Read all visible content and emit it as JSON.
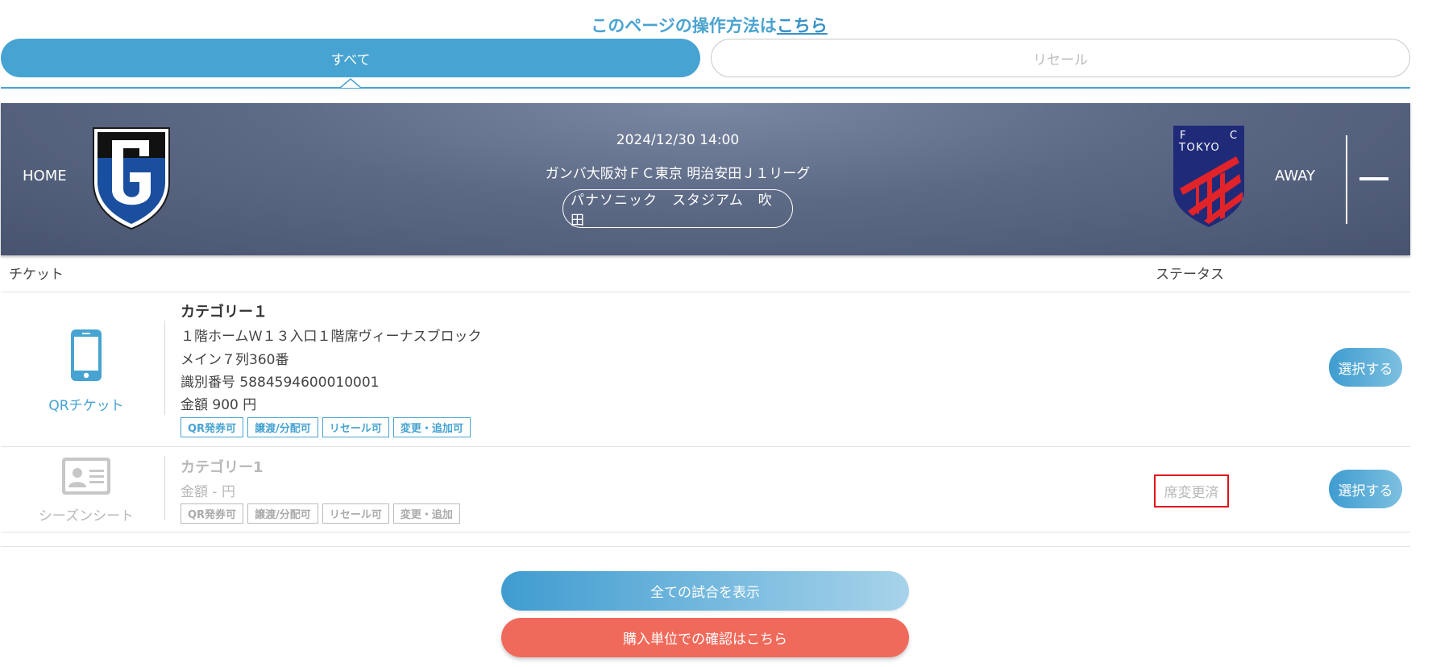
{
  "howto": {
    "prefix": "このページの操作方法は",
    "link": "こちら"
  },
  "tabs": [
    {
      "label": "すべて",
      "active": true
    },
    {
      "label": "リセール",
      "active": false
    }
  ],
  "match": {
    "home_label": "HOME",
    "away_label": "AWAY",
    "date": "2024/12/30 14:00",
    "name": "ガンバ大阪対ＦＣ東京 明治安田Ｊ１リーグ",
    "venue": "パナソニック　スタジアム　吹田",
    "home_logo_icon": "gamba-osaka-emblem-icon",
    "away_logo_icon": "fc-tokyo-emblem-icon",
    "away_logo_text": {
      "f": "F",
      "c": "C",
      "tokyo": "TOKYO"
    }
  },
  "columns": {
    "ticket": "チケット",
    "status": "ステータス"
  },
  "tickets": [
    {
      "type_label": "QRチケット",
      "type_icon": "smartphone-icon",
      "category": "カテゴリー１",
      "lines": [
        "１階ホームＷ１３入口１階席ヴィーナスブロック",
        "メイン７列360番",
        "識別番号 5884594600010001",
        "金額 900 円"
      ],
      "tags": [
        "QR発券可",
        "譲渡/分配可",
        "リセール可",
        "変更・追加可"
      ],
      "status": "",
      "action": "選択する"
    },
    {
      "type_label": "シーズンシート",
      "type_icon": "id-card-icon",
      "category": "カテゴリー1",
      "lines": [
        "金額 - 円"
      ],
      "tags": [
        "QR発券可",
        "譲渡/分配可",
        "リセール可",
        "変更・追加"
      ],
      "status": "席変更済",
      "action": "選択する"
    }
  ],
  "buttons": {
    "show_all": "全ての試合を表示",
    "purchase_unit": "購入単位での確認はこちら"
  },
  "colors": {
    "accent": "#47a3d1",
    "status_highlight": "#e0141e",
    "cta": "#f06a5b",
    "banner": "#5d6a86"
  }
}
